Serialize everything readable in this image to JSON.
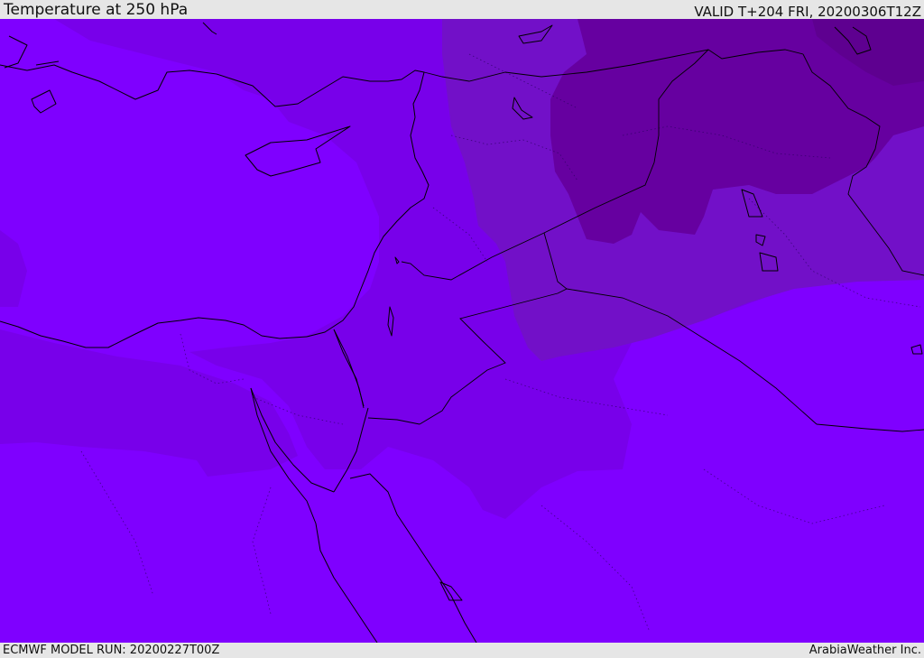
{
  "header": {
    "title": "Temperature at 250 hPa",
    "valid": "VALID T+204 FRI, 20200306T12Z"
  },
  "footer": {
    "model_run": "ECMWF MODEL RUN: 20200227T00Z",
    "credit": "ArabiaWeather Inc."
  },
  "colors": {
    "band_warmest": "#7f00ff",
    "band_warm": "#7800ea",
    "band_mid": "#7210c8",
    "band_cool": "#6600a0",
    "band_coolest": "#5e0090",
    "coastline": "#000000"
  }
}
